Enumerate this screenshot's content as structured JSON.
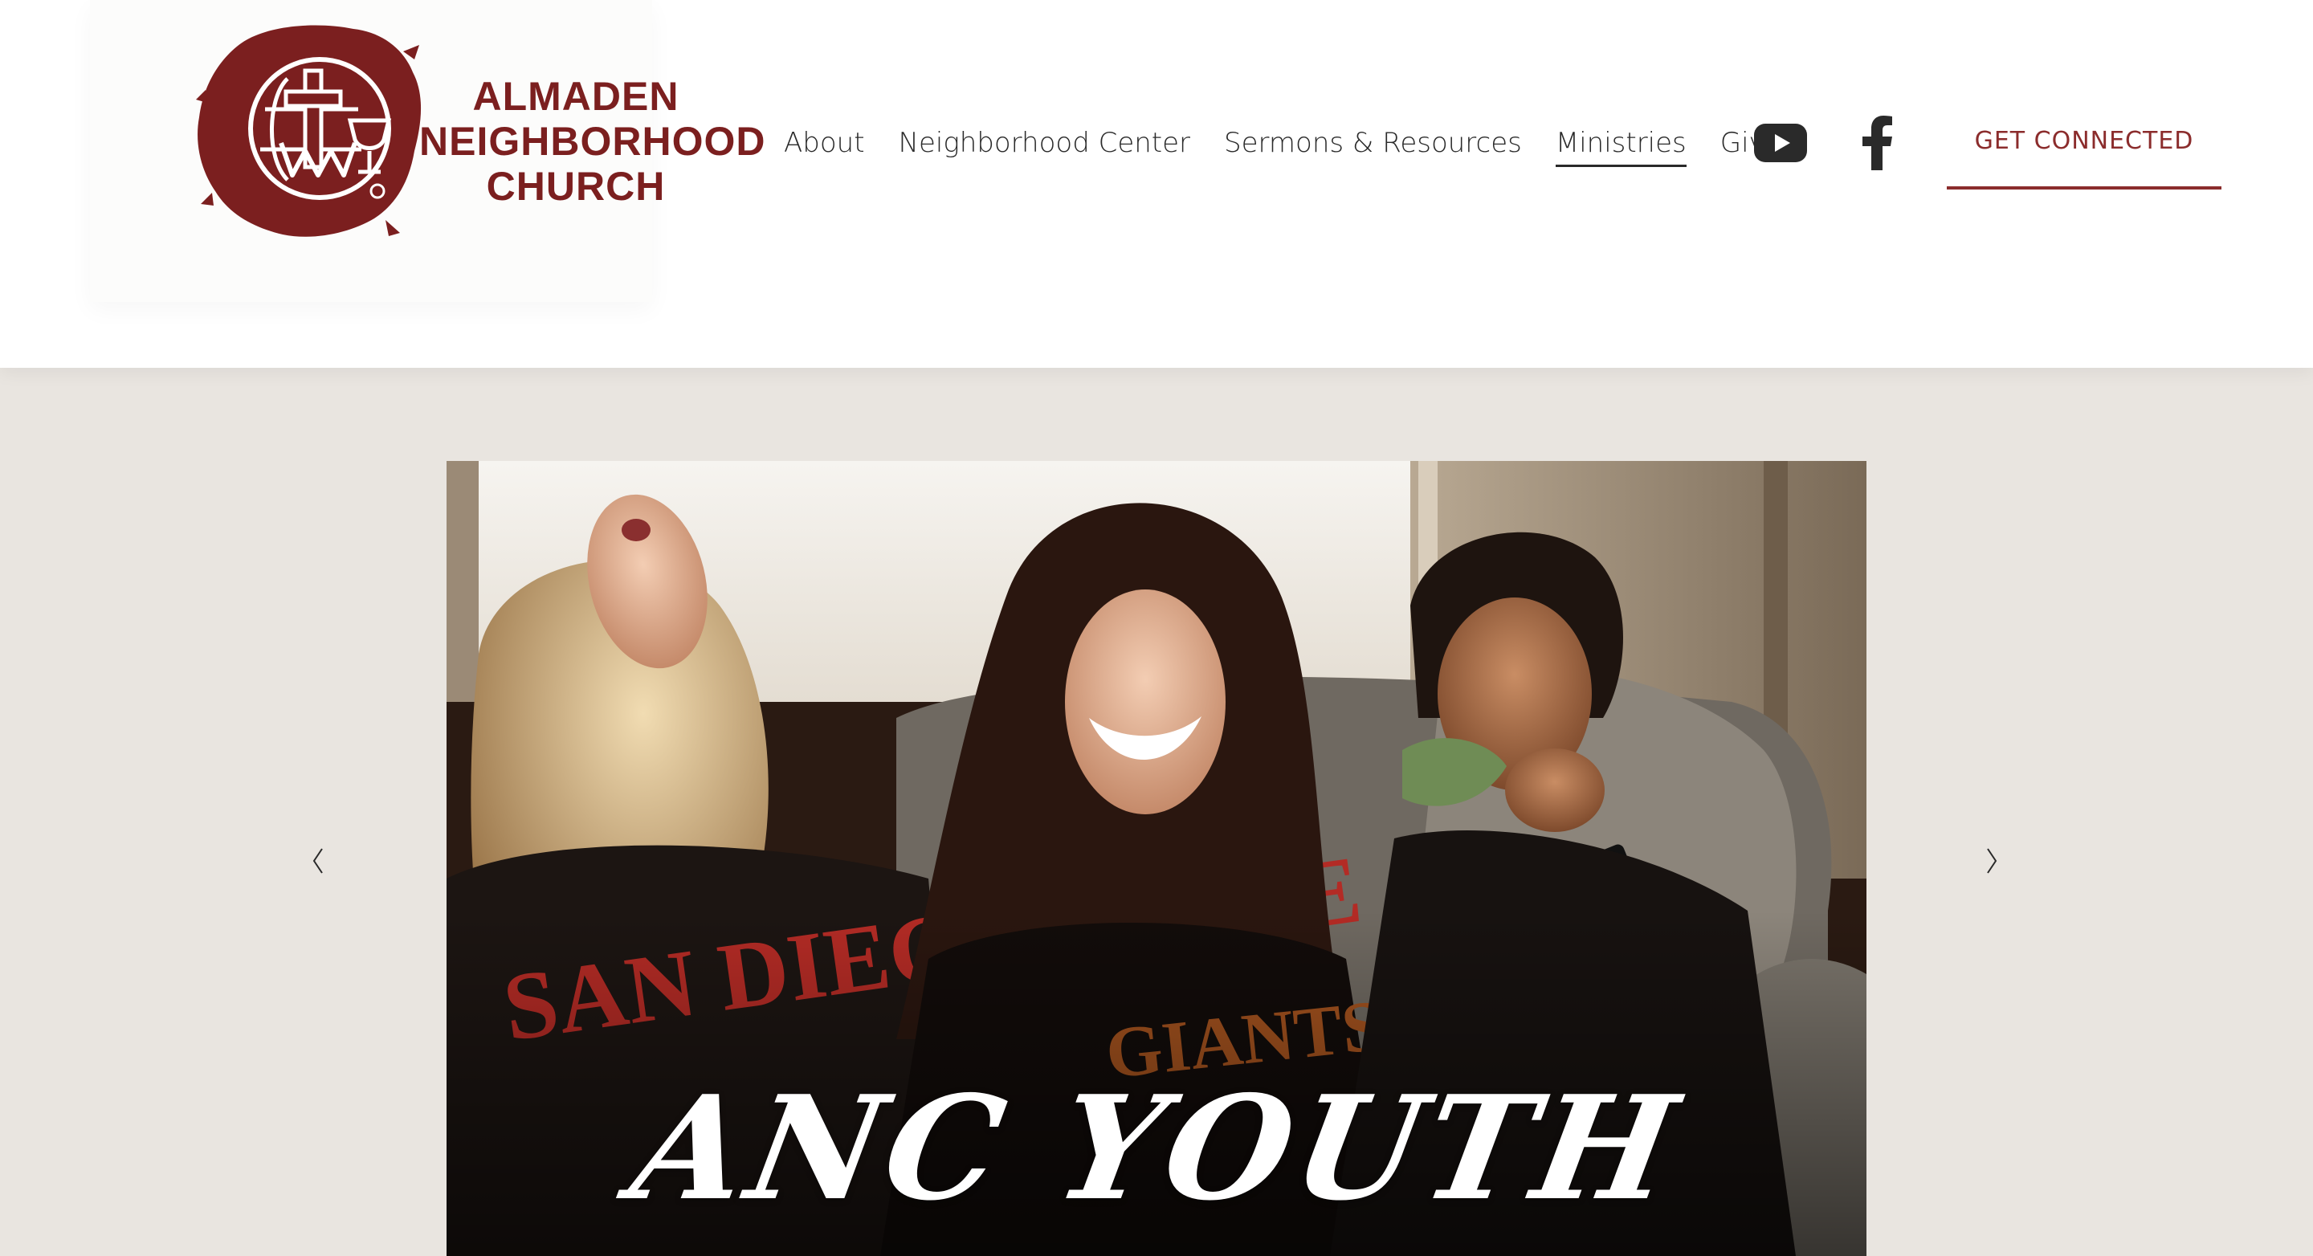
{
  "brand": {
    "name_lines": [
      "ALMADEN",
      "NEIGHBORHOOD",
      "CHURCH"
    ],
    "color": "#7b1f1f"
  },
  "nav": {
    "items": [
      {
        "label": "About",
        "active": false
      },
      {
        "label": "Neighborhood Center",
        "active": false
      },
      {
        "label": "Sermons & Resources",
        "active": false
      },
      {
        "label": "Ministries",
        "active": true
      },
      {
        "label": "Give",
        "active": false
      }
    ],
    "social": [
      "youtube-icon",
      "facebook-icon"
    ]
  },
  "cta": {
    "label": "GET CONNECTED",
    "color": "#8b2c2c"
  },
  "hero": {
    "caption": "ANC YOUTH",
    "prev_icon": "chevron-left-icon",
    "next_icon": "chevron-right-icon"
  },
  "colors": {
    "page_bg": "#e9e5e0",
    "header_bg": "#ffffff",
    "text": "#2a2a2a"
  }
}
